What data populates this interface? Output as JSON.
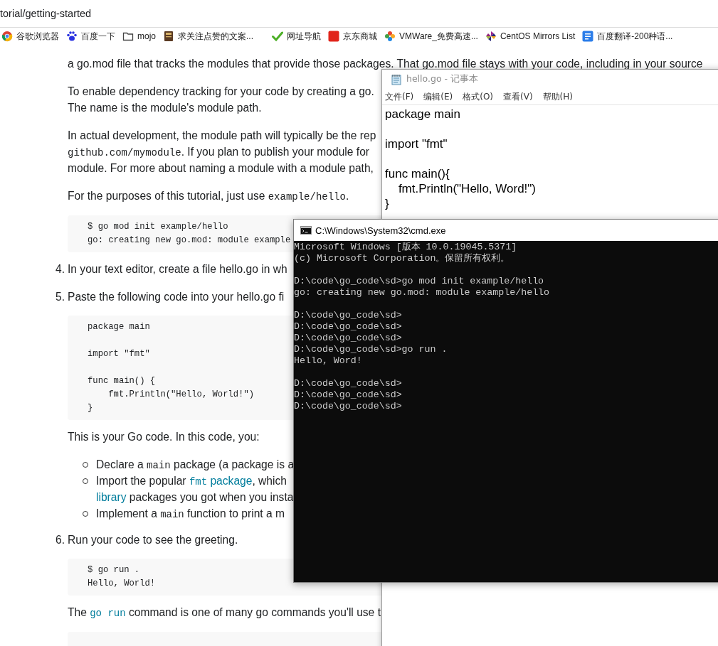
{
  "address_bar": {
    "url": "torial/getting-started"
  },
  "bookmarks": [
    {
      "label": "谷歌浏览器"
    },
    {
      "label": "百度一下"
    },
    {
      "label": "mojo"
    },
    {
      "label": "求关注点赞的文案..."
    },
    {
      "label": "网址导航"
    },
    {
      "label": "京东商城"
    },
    {
      "label": "VMWare_免费高速..."
    },
    {
      "label": "CentOS Mirrors List"
    },
    {
      "label": "百度翻译-200种语..."
    }
  ],
  "article": {
    "blocks": [
      {
        "kind": "paragraph",
        "lines": [
          [
            {
              "kind": "text",
              "text": "a go.mod file that tracks the modules that provide those packages. That go.mod file stays with your code, including in your source"
            }
          ]
        ]
      },
      {
        "kind": "paragraph",
        "lines": [
          [
            {
              "kind": "text",
              "text": "To enable dependency tracking for your code by creating a go."
            }
          ],
          [
            {
              "kind": "text",
              "text": "The name is the module's module path."
            }
          ]
        ]
      },
      {
        "kind": "paragraph",
        "lines": [
          [
            {
              "kind": "text",
              "text": "In actual development, the module path will typically be the rep"
            }
          ],
          [
            {
              "kind": "code",
              "text": "github.com/mymodule"
            },
            {
              "kind": "text",
              "text": ". If you plan to publish your module for"
            }
          ],
          [
            {
              "kind": "text",
              "text": "module. For more about naming a module with a module path,"
            }
          ]
        ]
      },
      {
        "kind": "paragraph",
        "lines": [
          [
            {
              "kind": "text",
              "text": "For the purposes of this tutorial, just use "
            },
            {
              "kind": "code",
              "text": "example/hello"
            },
            {
              "kind": "text",
              "text": "."
            }
          ]
        ]
      },
      {
        "kind": "code",
        "groups": [
          [
            "$ go mod init example/hello",
            "go: creating new go.mod: module example"
          ]
        ]
      },
      {
        "kind": "step",
        "number": "4.",
        "lines": [
          [
            {
              "kind": "text",
              "text": "In your text editor, create a file hello.go in wh"
            }
          ]
        ]
      },
      {
        "kind": "step",
        "number": "5.",
        "lines": [
          [
            {
              "kind": "text",
              "text": "Paste the following code into your hello.go fi"
            }
          ]
        ]
      },
      {
        "kind": "code",
        "groups": [
          [
            "package main"
          ],
          [
            "import \"fmt\""
          ],
          [
            "func main() {",
            "    fmt.Println(\"Hello, World!\")",
            "}"
          ]
        ]
      },
      {
        "kind": "paragraph",
        "lines": [
          [
            {
              "kind": "text",
              "text": "This is your Go code. In this code, you:"
            }
          ]
        ]
      },
      {
        "kind": "bullets",
        "items": [
          {
            "lines": [
              [
                {
                  "kind": "text",
                  "text": "Declare a "
                },
                {
                  "kind": "code",
                  "text": "main"
                },
                {
                  "kind": "text",
                  "text": " package (a package is a"
                }
              ]
            ]
          },
          {
            "lines": [
              [
                {
                  "kind": "text",
                  "text": "Import the popular "
                },
                {
                  "kind": "code_link",
                  "text": "fmt"
                },
                {
                  "kind": "link",
                  "text": " package"
                },
                {
                  "kind": "text",
                  "text": ", which"
                }
              ],
              [
                {
                  "kind": "link",
                  "text": "library"
                },
                {
                  "kind": "text",
                  "text": " packages you got when you insta"
                }
              ]
            ]
          },
          {
            "lines": [
              [
                {
                  "kind": "text",
                  "text": "Implement a "
                },
                {
                  "kind": "code",
                  "text": "main"
                },
                {
                  "kind": "text",
                  "text": " function to print a m"
                }
              ]
            ]
          }
        ]
      },
      {
        "kind": "step",
        "number": "6.",
        "lines": [
          [
            {
              "kind": "text",
              "text": "Run your code to see the greeting."
            }
          ]
        ]
      },
      {
        "kind": "code",
        "groups": [
          [
            "$ go run .",
            "Hello, World!"
          ]
        ]
      },
      {
        "kind": "paragraph",
        "lines": [
          [
            {
              "kind": "text",
              "text": "The "
            },
            {
              "kind": "code_link",
              "text": "go run"
            },
            {
              "kind": "text",
              "text": " command is one of many go commands you'll use t"
            }
          ]
        ]
      },
      {
        "kind": "code"
      }
    ]
  },
  "notepad": {
    "title": "hello.go - 记事本",
    "menu": [
      "文件(F)",
      "编辑(E)",
      "格式(O)",
      "查看(V)",
      "帮助(H)"
    ],
    "groups": [
      [
        "package main"
      ],
      [
        "import \"fmt\""
      ],
      [
        "func main(){",
        "    fmt.Println(\"Hello, Word!\")",
        "}"
      ]
    ]
  },
  "console": {
    "title": "C:\\Windows\\System32\\cmd.exe",
    "groups": [
      [
        "Microsoft Windows [版本 10.0.19045.5371]",
        "(c) Microsoft Corporation。保留所有权利。"
      ],
      [
        "D:\\code\\go_code\\sd>go mod init example/hello",
        "go: creating new go.mod: module example/hello"
      ],
      [
        "D:\\code\\go_code\\sd>",
        "D:\\code\\go_code\\sd>",
        "D:\\code\\go_code\\sd>",
        "D:\\code\\go_code\\sd>go run .",
        "Hello, Word!"
      ],
      [
        "D:\\code\\go_code\\sd>",
        "D:\\code\\go_code\\sd>",
        "D:\\code\\go_code\\sd>"
      ]
    ]
  }
}
